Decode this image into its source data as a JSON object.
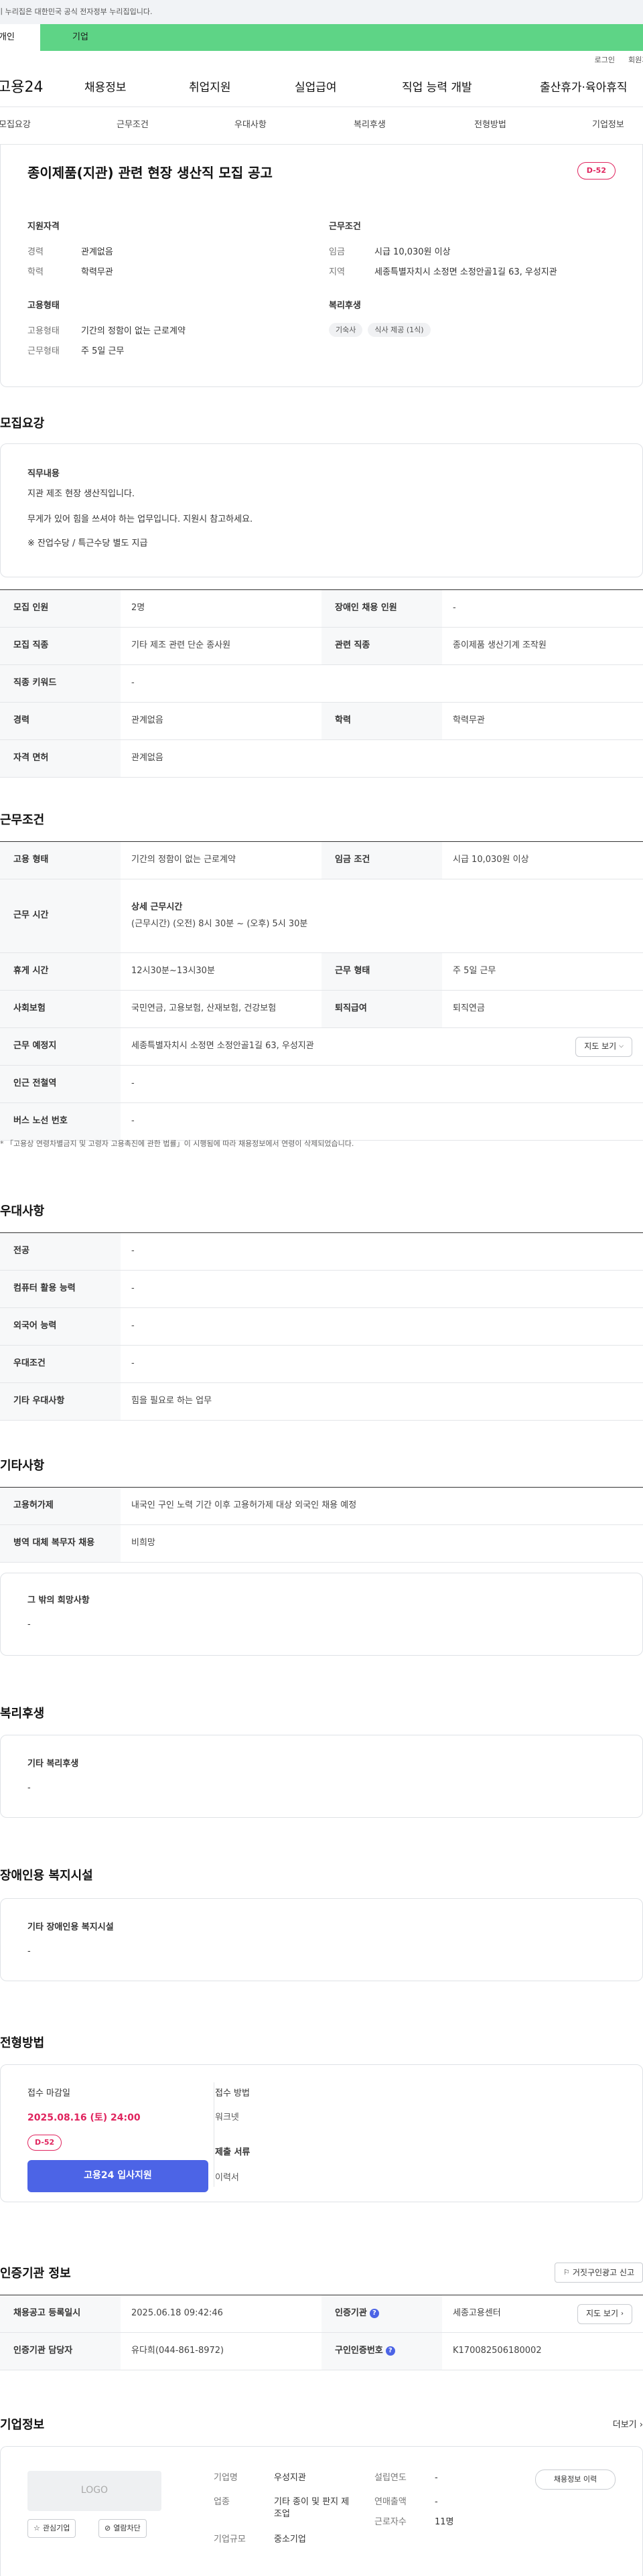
{
  "gov_banner": "이 누리집은 대한민국 공식 전자정부 누리집입니다.",
  "top_tabs": {
    "individual": "개인",
    "business": "기업"
  },
  "util": {
    "login": "로그인",
    "signup": "회원가입"
  },
  "logo": "고용24",
  "gnb": [
    "채용정보",
    "취업지원",
    "실업급여",
    "직업 능력 개발",
    "출산휴가·육아휴직"
  ],
  "subnav": [
    "모집요강",
    "근무조건",
    "우대사항",
    "복리후생",
    "전형방법",
    "기업정보"
  ],
  "summary": {
    "title": "종이제품(지관) 관련 현장 생산직 모집 공고",
    "dday": "D-52",
    "qual_title": "지원자격",
    "qual": [
      {
        "k": "경력",
        "v": "관계없음"
      },
      {
        "k": "학력",
        "v": "학력무관"
      }
    ],
    "emp_title": "고용형태",
    "emp": [
      {
        "k": "고용형태",
        "v": "기간의 정함이 없는 근로계약"
      },
      {
        "k": "근무형태",
        "v": "주 5일 근무"
      }
    ],
    "cond_title": "근무조건",
    "cond": [
      {
        "k": "임금",
        "v": "시급 10,030원 이상"
      },
      {
        "k": "지역",
        "v": "세종특별자치시 소정면 소정안골1길 63, 우성지관"
      }
    ],
    "welfare_title": "복리후생",
    "welfare_chips": [
      "기숙사",
      "식사 제공 (1식)"
    ]
  },
  "recruit": {
    "title": "모집요강",
    "duty_title": "직무내용",
    "duty_lines": [
      "지관 제조 현장 생산직입니다.",
      "무게가 있어 힘을 쓰셔야 하는 업무입니다. 지원시 참고하세요.",
      "※ 잔업수당 / 특근수당 별도 지급"
    ],
    "table": {
      "headcount_k": "모집 인원",
      "headcount_v": "2명",
      "disabled_k": "장애인 채용 인원",
      "disabled_v": "-",
      "job_k": "모집 직종",
      "job_v": "기타 제조 관련 단순 종사원",
      "related_k": "관련 직종",
      "related_v": "종이제품 생산기계 조작원",
      "keyword_k": "직종 키워드",
      "keyword_v": "-",
      "career_k": "경력",
      "career_v": "관계없음",
      "edu_k": "학력",
      "edu_v": "학력무관",
      "license_k": "자격 면허",
      "license_v": "관계없음"
    }
  },
  "work": {
    "title": "근무조건",
    "emp_type_k": "고용 형태",
    "emp_type_v": "기간의 정함이 없는 근로계약",
    "wage_k": "임금 조건",
    "wage_v": "시급 10,030원 이상",
    "hours_k": "근무 시간",
    "hours_sub": "상세 근무시간",
    "hours_v": "(근무시간) (오전) 8시 30분 ~ (오후) 5시 30분",
    "break_k": "휴게 시간",
    "break_v": "12시30분~13시30분",
    "shift_k": "근무 형태",
    "shift_v": "주 5일 근무",
    "ins_k": "사회보험",
    "ins_v": "국민연금, 고용보험, 산재보험, 건강보험",
    "retire_k": "퇴직급여",
    "retire_v": "퇴직연금",
    "place_k": "근무 예정지",
    "place_v": "세종특별자치시 소정면 소정안골1길 63, 우성지관",
    "map_btn": "지도 보기",
    "station_k": "인근 전철역",
    "station_v": "-",
    "bus_k": "버스 노선 번호",
    "bus_v": "-",
    "note": "* 「고용상 연령차별금지 및 고령자 고용촉진에 관한 법률」이 시행됨에 따라 채용정보에서 연령이 삭제되었습니다."
  },
  "pref": {
    "title": "우대사항",
    "rows": [
      {
        "k": "전공",
        "v": "-"
      },
      {
        "k": "컴퓨터 활용 능력",
        "v": "-"
      },
      {
        "k": "외국어 능력",
        "v": "-"
      },
      {
        "k": "우대조건",
        "v": "-"
      },
      {
        "k": "기타 우대사항",
        "v": "힘을 필요로 하는 업무"
      }
    ]
  },
  "etc": {
    "title": "기타사항",
    "rows": [
      {
        "k": "고용허가제",
        "v": "내국인 구인 노력 기간 이후 고용허가제 대상 외국인 채용 예정"
      },
      {
        "k": "병역 대체 복무자 채용",
        "v": "비희망"
      }
    ],
    "other_title": "그 밖의 희망사항",
    "other_v": "-"
  },
  "welfare": {
    "title": "복리후생",
    "box_title": "기타 복리후생",
    "box_v": "-"
  },
  "disability": {
    "title": "장애인용 복지시설",
    "box_title": "기타 장애인용 복지시설",
    "box_v": "-"
  },
  "selection": {
    "title": "전형방법",
    "deadline_k": "접수 마감일",
    "deadline_v": "2025.08.16 (토) 24:00",
    "dday": "D-52",
    "apply": "고용24 입사지원",
    "method_k": "접수 방법",
    "method_v": "워크넷",
    "docs_k": "제출 서류",
    "docs_v": "이력서"
  },
  "cert": {
    "title": "인증기관 정보",
    "report_btn": "거짓구인광고 신고",
    "reg_k": "채용공고 등록일시",
    "reg_v": "2025.06.18 09:42:46",
    "org_k": "인증기관",
    "org_v": "세종고용센터",
    "map_btn": "지도 보기",
    "mgr_k": "인증기관 담당자",
    "mgr_v": "유다희(044-861-8972)",
    "no_k": "구인인증번호",
    "no_v": "K170082506180002"
  },
  "company": {
    "title": "기업정보",
    "more": "더보기",
    "logo": "LOGO",
    "fav_btn": "관심기업",
    "block_btn": "열람차단",
    "name_k": "기업명",
    "name_v": "우성지관",
    "ind_k": "업종",
    "ind_v": "기타 종이 및 판지 제조업",
    "size_k": "기업규모",
    "size_v": "중소기업",
    "est_k": "설립연도",
    "est_v": "-",
    "sales_k": "연매출액",
    "sales_v": "-",
    "emp_k": "근로자수",
    "emp_v": "11명",
    "history_btn": "채용정보 이력"
  }
}
